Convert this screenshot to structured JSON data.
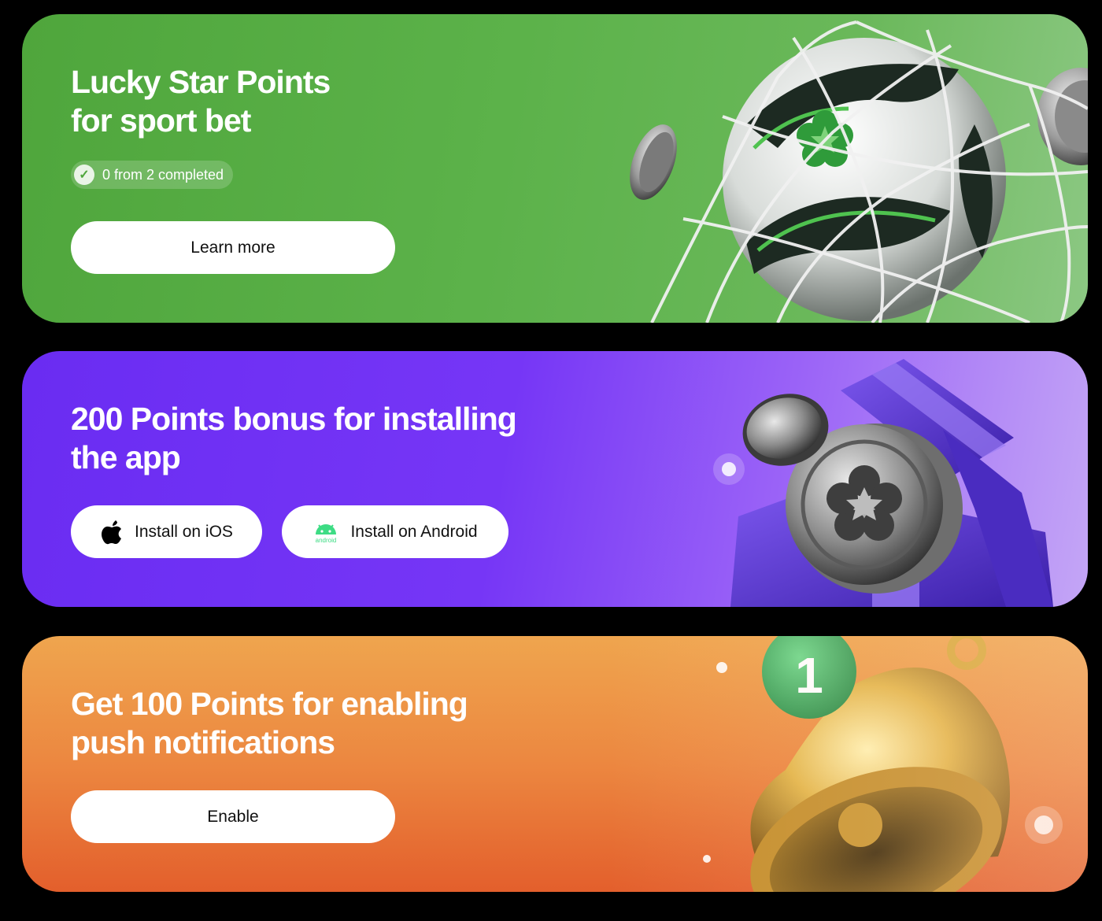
{
  "cards": [
    {
      "theme": "green",
      "title": "Lucky Star Points\nfor sport bet",
      "progress_text": "0 from 2 completed",
      "button_label": "Learn more",
      "art": "soccer-ball-in-net"
    },
    {
      "theme": "purple",
      "title": "200 Points bonus for installing\nthe app",
      "ios_label": "Install on iOS",
      "android_label": "Install on Android",
      "android_logo_text": "android",
      "art": "coins-gift-box"
    },
    {
      "theme": "orange",
      "title": "Get 100 Points for enabling\npush notifications",
      "button_label": "Enable",
      "notification_count": "1",
      "art": "golden-bell"
    }
  ],
  "colors": {
    "green": "#5cb24a",
    "purple": "#7636f6",
    "orange": "#ec8740",
    "button_bg": "#ffffff",
    "android_green": "#3ddc84",
    "badge_green": "#3fae5a"
  },
  "icons": [
    "check-icon",
    "apple-icon",
    "android-icon",
    "bell-icon",
    "coin-icon"
  ]
}
